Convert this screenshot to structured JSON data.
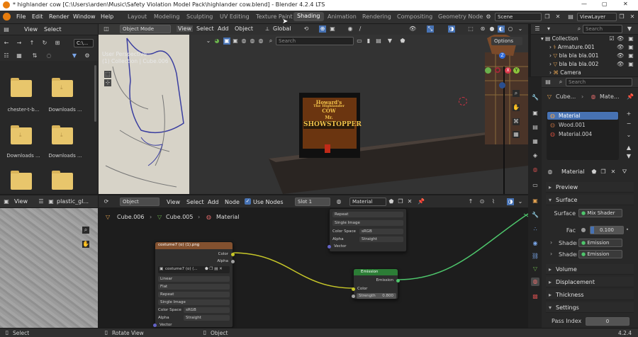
{
  "titlebar": {
    "title": "* highlander cow [C:\\Users\\arden\\Music\\Safety Violation Model Pack\\highlander cow.blend] - Blender 4.2.4 LTS",
    "minimize": "—",
    "maximize": "▢",
    "close": "✕"
  },
  "menubar": {
    "items": [
      "File",
      "Edit",
      "Render",
      "Window",
      "Help"
    ],
    "workspaces": [
      "Layout",
      "Modeling",
      "Sculpting",
      "UV Editing",
      "Texture Paint",
      "Shading",
      "Animation",
      "Rendering",
      "Compositing",
      "Geometry Node"
    ],
    "active_workspace": "Shading",
    "scene": "Scene",
    "view_layer": "ViewLayer"
  },
  "file_browser": {
    "menu": [
      "View",
      "Select"
    ],
    "path": "C:\\...",
    "items": [
      "chester-t-b...",
      "Downloads ...",
      "Downloads ...",
      "Downloads ...",
      "",
      ""
    ]
  },
  "viewport": {
    "mode": "Object Mode",
    "menu": [
      "View",
      "Select",
      "Add",
      "Object"
    ],
    "orientation": "Global",
    "search_placeholder": "Search",
    "options": "Options",
    "overlay_line1": "User Perspective",
    "overlay_line2": "(1) Collection | Cube.006",
    "poster": {
      "line1": "Howard's",
      "line2": "The Highlander",
      "line3": "COW",
      "line4": "Mr.",
      "line5": "SHOWSTOPPER"
    }
  },
  "outliner": {
    "search_placeholder": "Search",
    "rows": [
      {
        "name": "Collection",
        "icon": "collection-icon"
      },
      {
        "name": "Armature.001",
        "icon": "armature-icon"
      },
      {
        "name": "bla bla bla.001",
        "icon": "mesh-icon"
      },
      {
        "name": "bla bla bla.002",
        "icon": "mesh-icon"
      },
      {
        "name": "Camera",
        "icon": "camera-icon"
      }
    ]
  },
  "properties": {
    "crumb_object": "Cube...",
    "crumb_material": "Mate...",
    "search_placeholder": "Search",
    "slots": [
      "Material",
      "Wood.001",
      "Material.004"
    ],
    "material_name": "Material",
    "panels": {
      "preview": "Preview",
      "surface": "Surface",
      "volume": "Volume",
      "displacement": "Displacement",
      "thickness": "Thickness",
      "settings": "Settings"
    },
    "surface_label": "Surface",
    "surface_value": "Mix Shader",
    "fac_label": "Fac",
    "fac_value": "0.100",
    "shader1_label": "Shader",
    "shader1_value": "Emission",
    "shader2_label": "Shader",
    "shader2_value": "Emission",
    "pass_index_label": "Pass Index",
    "pass_index_value": "0"
  },
  "image_editor": {
    "menu": [
      "View"
    ],
    "image_name": "plastic_gl..."
  },
  "node_editor": {
    "type": "Object",
    "menu": [
      "View",
      "Select",
      "Add",
      "Node"
    ],
    "use_nodes": "Use Nodes",
    "slot": "Slot 1",
    "material": "Material",
    "breadcrumb": [
      "Cube.006",
      "Cube.005",
      "Material"
    ],
    "upper_node": {
      "rows": [
        "Repeat",
        "Single Image",
        "Color Space",
        "sRGB",
        "Alpha",
        "Straight",
        "Vector"
      ]
    },
    "image_node": {
      "title": "costume7 (o) (1).png",
      "image": "costume7 (o) (...",
      "out_color": "Color",
      "out_alpha": "Alpha",
      "interp": "Linear",
      "proj": "Flat",
      "ext": "Repeat",
      "source": "Single Image",
      "cs_label": "Color Space",
      "cs_value": "sRGB",
      "alpha_label": "Alpha",
      "alpha_value": "Straight",
      "vector": "Vector"
    },
    "emission_node": {
      "title": "Emission",
      "out": "Emission",
      "color": "Color",
      "strength_label": "Strength",
      "strength_value": "0.800"
    }
  },
  "statusbar": {
    "select": "Select",
    "rotate": "Rotate View",
    "object": "Object",
    "version": "4.2.4"
  },
  "colors": {
    "accent": "#4772b3",
    "active_slot": "#4772b3",
    "wire": "#c7c729",
    "shader_wire": "#4ec66c",
    "node_header_image": "#83512f",
    "node_header_emission": "#2c7d36"
  }
}
